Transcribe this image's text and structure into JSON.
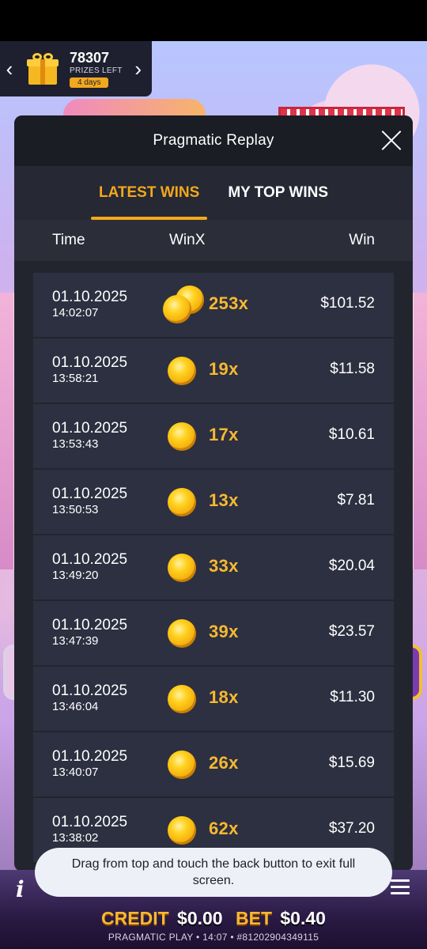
{
  "prize_widget": {
    "count": "78307",
    "label": "PRIZES LEFT",
    "days": "4 days",
    "prev_arrow": "‹",
    "next_arrow": "›",
    "icon": "gift-icon"
  },
  "modal": {
    "title": "Pragmatic Replay",
    "close_icon": "close-icon",
    "tabs": [
      {
        "label": "LATEST WINS",
        "active": true
      },
      {
        "label": "MY TOP WINS",
        "active": false
      }
    ],
    "columns": {
      "time": "Time",
      "winx": "WinX",
      "win": "Win"
    },
    "rows": [
      {
        "date": "01.10.2025",
        "time": "14:02:07",
        "winx": "253x",
        "win": "$101.52",
        "coins": 2
      },
      {
        "date": "01.10.2025",
        "time": "13:58:21",
        "winx": "19x",
        "win": "$11.58",
        "coins": 1
      },
      {
        "date": "01.10.2025",
        "time": "13:53:43",
        "winx": "17x",
        "win": "$10.61",
        "coins": 1
      },
      {
        "date": "01.10.2025",
        "time": "13:50:53",
        "winx": "13x",
        "win": "$7.81",
        "coins": 1
      },
      {
        "date": "01.10.2025",
        "time": "13:49:20",
        "winx": "33x",
        "win": "$20.04",
        "coins": 1
      },
      {
        "date": "01.10.2025",
        "time": "13:47:39",
        "winx": "39x",
        "win": "$23.57",
        "coins": 1
      },
      {
        "date": "01.10.2025",
        "time": "13:46:04",
        "winx": "18x",
        "win": "$11.30",
        "coins": 1
      },
      {
        "date": "01.10.2025",
        "time": "13:40:07",
        "winx": "26x",
        "win": "$15.69",
        "coins": 1
      },
      {
        "date": "01.10.2025",
        "time": "13:38:02",
        "winx": "62x",
        "win": "$37.20",
        "coins": 1
      }
    ]
  },
  "toast": {
    "text": "Drag from top and touch the back button to exit full screen."
  },
  "game_footer": {
    "info_icon": "i",
    "credit_label": "CREDIT",
    "credit_value": "$0.00",
    "bet_label": "BET",
    "bet_value": "$0.40",
    "footer_text": "PRAGMATIC PLAY • 14:07 • #81202904349115"
  },
  "colors": {
    "accent": "#f2a81d",
    "modal_bg": "#23252e",
    "row_bg": "#2d3040",
    "winx_gold": "#f7b832"
  }
}
